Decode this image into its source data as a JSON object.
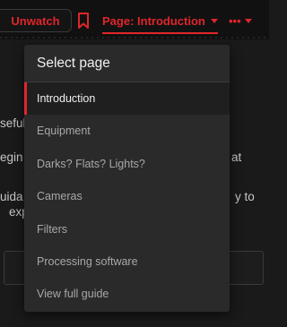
{
  "toolbar": {
    "unwatch_label": "Unwatch",
    "page_label": "Page: Introduction",
    "more_label": "•••",
    "accent_color": "#e0262b"
  },
  "background": {
    "line1": "seful",
    "line2a": "egin",
    "line2b": "at",
    "line3a": "uida",
    "line3b": "y to",
    "line4": "expl"
  },
  "menu": {
    "title": "Select page",
    "items": [
      {
        "label": "Introduction",
        "selected": true
      },
      {
        "label": "Equipment"
      },
      {
        "label": "Darks? Flats? Lights?"
      },
      {
        "label": "Cameras"
      },
      {
        "label": "Filters"
      },
      {
        "label": "Processing software"
      },
      {
        "label": "View full guide"
      }
    ]
  }
}
